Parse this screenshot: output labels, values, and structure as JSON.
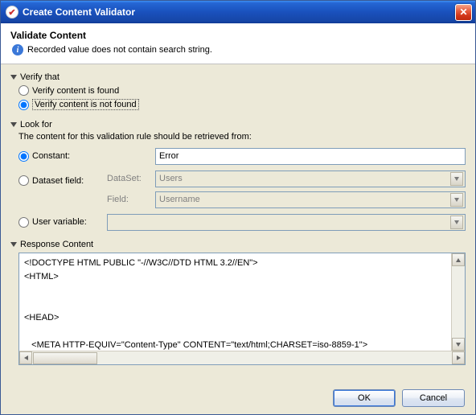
{
  "window": {
    "title": "Create Content Validator",
    "icon_glyph": "✔"
  },
  "header": {
    "title": "Validate Content",
    "info_text": "Recorded value does not contain search string."
  },
  "verify_that": {
    "section_label": "Verify that",
    "option_found": "Verify content is found",
    "option_not_found": "Verify content is not found",
    "selected": "not_found"
  },
  "look_for": {
    "section_label": "Look for",
    "description": "The content for this validation rule should be retrieved from:",
    "constant": {
      "label": "Constant:",
      "value": "Error"
    },
    "dataset_field": {
      "label": "Dataset field:",
      "dataset_label": "DataSet:",
      "dataset_value": "Users",
      "field_label": "Field:",
      "field_value": "Username"
    },
    "user_variable": {
      "label": "User variable:",
      "value": ""
    },
    "selected": "constant"
  },
  "response": {
    "section_label": "Response Content",
    "content": "<!DOCTYPE HTML PUBLIC \"-//W3C//DTD HTML 3.2//EN\">\n<HTML>\n\n\n<HEAD>\n\n   <META HTTP-EQUIV=\"Content-Type\" CONTENT=\"text/html;CHARSET=iso-8859-1\">"
  },
  "buttons": {
    "ok": "OK",
    "cancel": "Cancel"
  }
}
